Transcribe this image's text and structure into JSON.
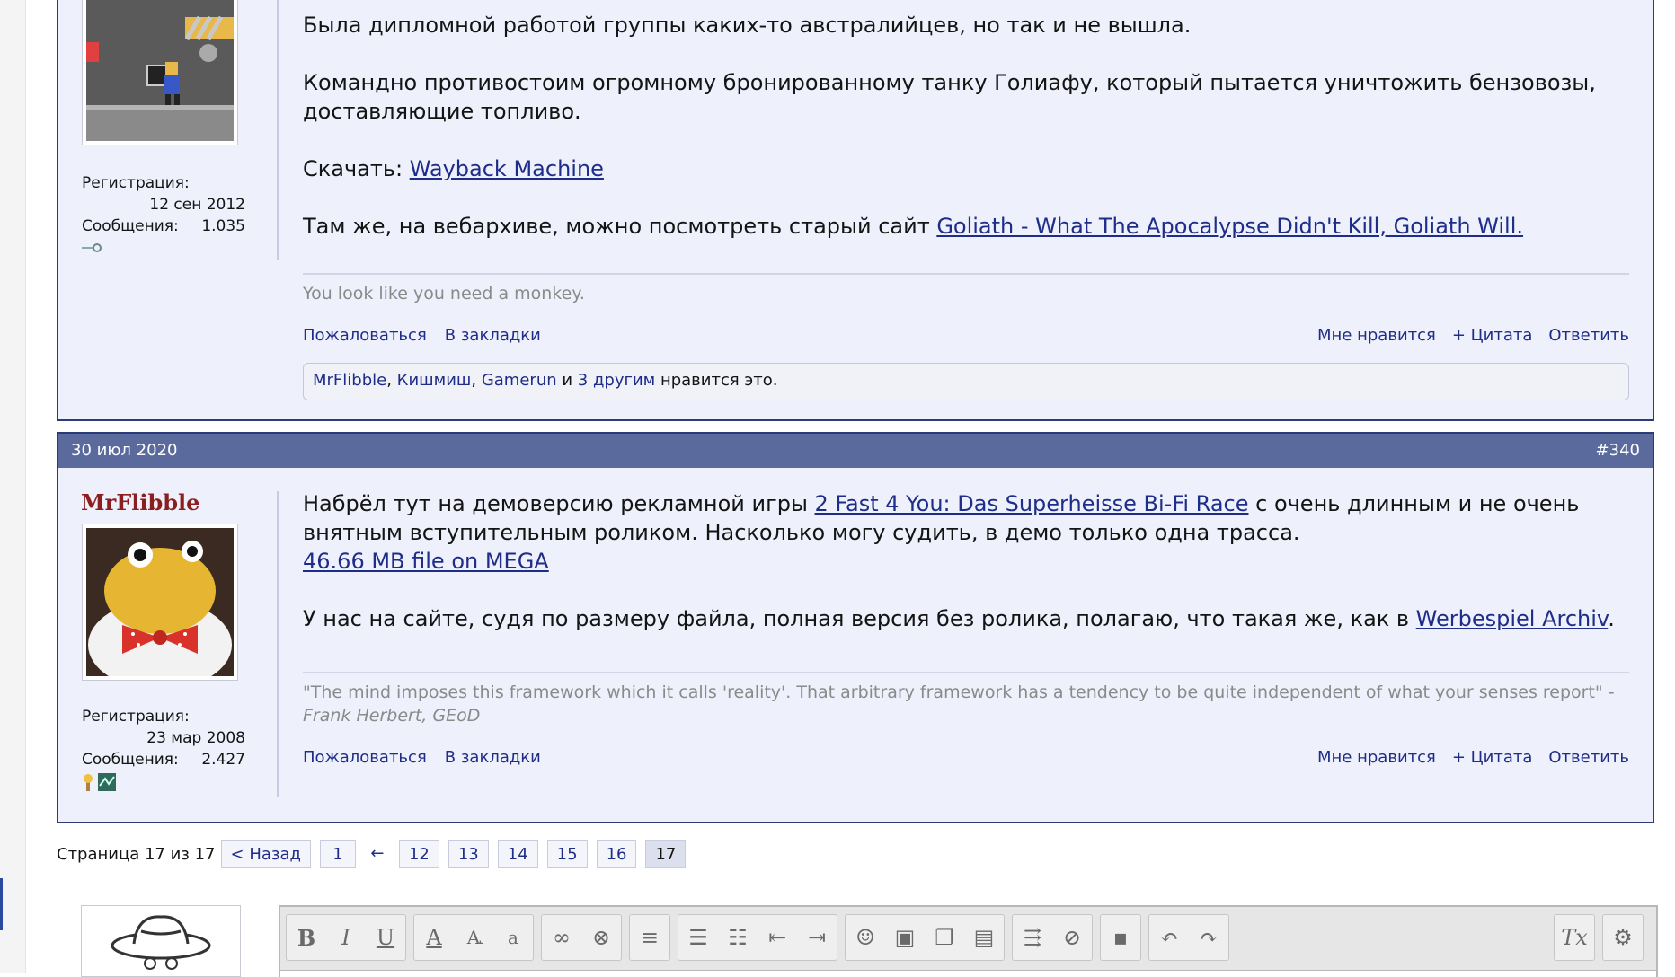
{
  "colors": {
    "header_bg": "#5a6a9c",
    "post_bg": "#eef0fb",
    "link": "#1f2d8a",
    "username": "#8b1e1e"
  },
  "post_prev": {
    "paragraphs": [
      {
        "text": "Была дипломной работой группы каких-то австралийцев, но так и не вышла."
      },
      {
        "text": "Командно противостоим огромному бронированному танку Голиафу, который пытается уничтожить бензовозы, доставляющие топливо."
      },
      {
        "prefix": "Скачать: ",
        "link": "Wayback Machine"
      },
      {
        "prefix": "Там же, на вебархиве, можно посмотреть старый сайт ",
        "link": "Goliath - What The Apocalypse Didn't Kill, Goliath Will."
      }
    ],
    "user": {
      "reg_label": "Регистрация:",
      "reg_date": "12 сен 2012",
      "msg_label": "Сообщения:",
      "msg_count": "1.035"
    },
    "signature": "You look like you need a monkey.",
    "actions": {
      "report": "Пожаловаться",
      "bookmark": "В закладки",
      "like": "Мне нравится",
      "quote": "+ Цитата",
      "reply": "Ответить"
    },
    "likes": {
      "u1": "MrFlibble",
      "sep1": ", ",
      "u2": "Кишмиш",
      "sep2": ", ",
      "u3": "Gamerun",
      "and": " и ",
      "others": "3 другим",
      "suffix": " нравится это."
    }
  },
  "post_340": {
    "date": "30 июл 2020",
    "number": "#340",
    "username": "MrFlibble",
    "user": {
      "reg_label": "Регистрация:",
      "reg_date": "23 мар 2008",
      "msg_label": "Сообщения:",
      "msg_count": "2.427"
    },
    "p1_prefix": "Набрёл тут на демоверсию рекламной игры ",
    "p1_link": "2 Fast 4 You: Das Superheisse Bi-Fi Race",
    "p1_suffix": " с очень длинным и не очень внятным вступительным роликом. Насколько могу судить, в демо только одна трасса.",
    "p1_link2": "46.66 MB file on MEGA",
    "p2_prefix": "У нас на сайте, судя по размеру файла, полная версия без ролика, полагаю, что такая же, как в ",
    "p2_link": "Werbespiel Archiv",
    "p2_suffix": ".",
    "signature": "\"The mind imposes this framework which it calls 'reality'. That arbitrary framework has a tendency to be quite independent of what your senses report\" -",
    "signature_author": "Frank Herbert, GEoD",
    "actions": {
      "report": "Пожаловаться",
      "bookmark": "В закладки",
      "like": "Мне нравится",
      "quote": "+ Цитата",
      "reply": "Ответить"
    }
  },
  "pagination": {
    "label": "Страница 17 из 17",
    "prev": "< Назад",
    "first": "1",
    "ellipsis_arrow": "←",
    "pages": [
      "12",
      "13",
      "14",
      "15",
      "16",
      "17"
    ],
    "current": "17"
  },
  "editor": {
    "tool_icons": [
      "bold-icon",
      "italic-icon",
      "underline-icon",
      "text-color-icon",
      "font-size-icon",
      "font-family-icon",
      "link-icon",
      "unlink-icon",
      "align-icon",
      "bullet-list-icon",
      "numbered-list-icon",
      "outdent-icon",
      "indent-icon",
      "smilie-icon",
      "image-icon",
      "media-icon",
      "quote-icon",
      "code-icon",
      "spoiler-icon",
      "save-draft-icon",
      "undo-icon",
      "redo-icon",
      "remove-format-icon",
      "toggle-bbcode-icon"
    ]
  }
}
